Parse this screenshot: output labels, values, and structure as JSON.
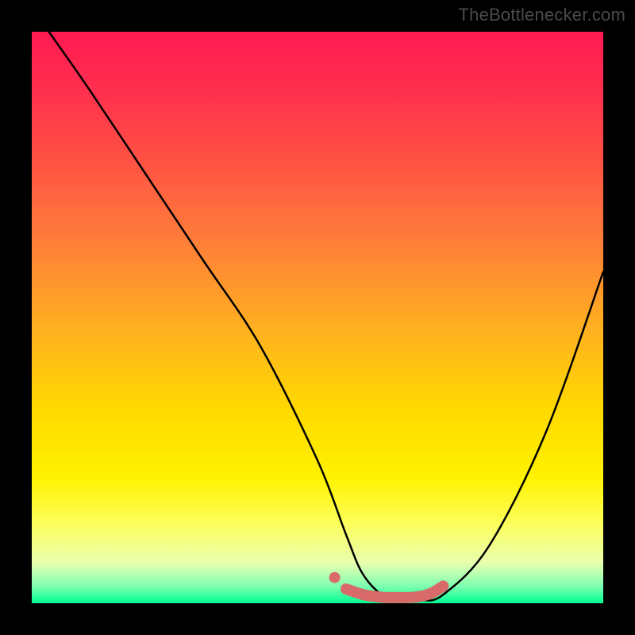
{
  "attribution": "TheBottlenecker.com",
  "chart_data": {
    "type": "line",
    "title": "",
    "xlabel": "",
    "ylabel": "",
    "xlim": [
      0,
      100
    ],
    "ylim": [
      0,
      100
    ],
    "background_gradient": {
      "top": "#ff1a52",
      "mid1": "#ffb020",
      "mid2": "#fff200",
      "bottom": "#00ff94"
    },
    "series": [
      {
        "name": "bottleneck-curve",
        "color": "#000000",
        "x": [
          3,
          10,
          20,
          30,
          40,
          50,
          55,
          58,
          62,
          66,
          68,
          72,
          80,
          90,
          100
        ],
        "y": [
          100,
          90,
          75,
          60,
          45,
          25,
          12,
          5,
          1,
          0.5,
          0.5,
          1.5,
          10,
          30,
          58
        ]
      },
      {
        "name": "highlight-band",
        "color": "#d86a6a",
        "x": [
          55,
          58,
          60,
          62,
          64,
          66,
          68,
          70,
          72
        ],
        "y": [
          2.5,
          1.5,
          1.2,
          1.0,
          1.0,
          1.0,
          1.2,
          1.8,
          3.0
        ]
      }
    ]
  }
}
